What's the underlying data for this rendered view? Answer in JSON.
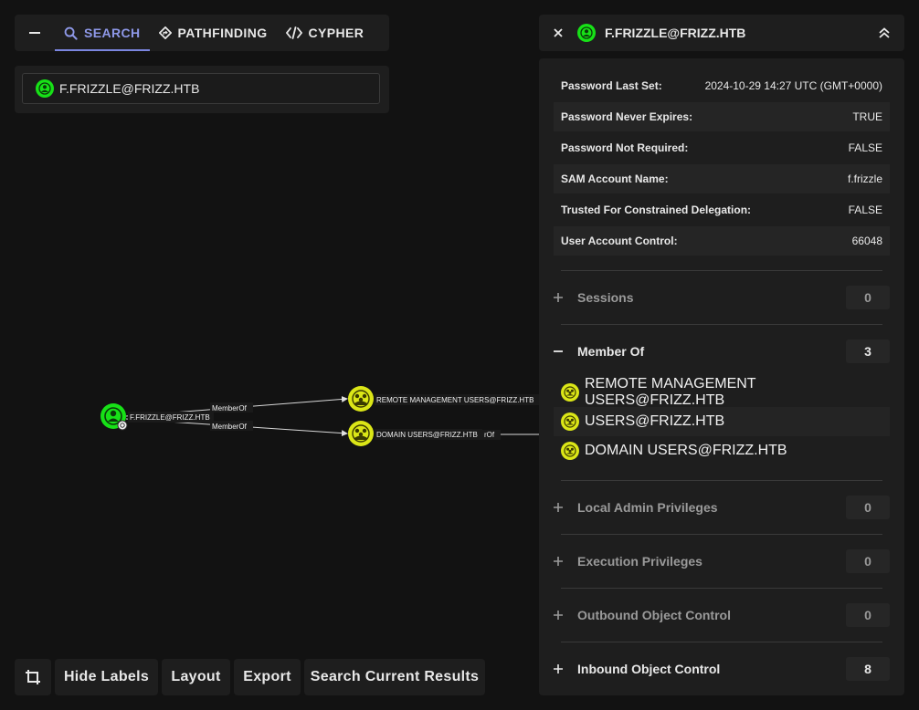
{
  "tabs": {
    "items": [
      {
        "label": "SEARCH",
        "icon": "search-icon",
        "active": true
      },
      {
        "label": "PATHFINDING",
        "icon": "pathfinding-icon",
        "active": false
      },
      {
        "label": "CYPHER",
        "icon": "code-icon",
        "active": false
      }
    ]
  },
  "search": {
    "value": "F.FRIZZLE@FRIZZ.HTB"
  },
  "graph": {
    "nodes": {
      "user": "F.FRIZZLE@FRIZZ.HTB",
      "group1": "REMOTE MANAGEMENT USERS@FRIZZ.HTB",
      "group2": "DOMAIN USERS@FRIZZ.HTB"
    },
    "edges": {
      "e1": "MemberOf",
      "e2": "MemberOf",
      "e3_partial": "rOf"
    }
  },
  "toolbar": {
    "hide_labels": "Hide Labels",
    "layout": "Layout",
    "export": "Export",
    "search_current": "Search Current Results"
  },
  "entity_panel": {
    "title": "F.FRIZZLE@FRIZZ.HTB",
    "properties": [
      {
        "key": "Password Last Set:",
        "value": "2024-10-29 14:27 UTC (GMT+0000)"
      },
      {
        "key": "Password Never Expires:",
        "value": "TRUE"
      },
      {
        "key": "Password Not Required:",
        "value": "FALSE"
      },
      {
        "key": "SAM Account Name:",
        "value": "f.frizzle"
      },
      {
        "key": "Trusted For Constrained Delegation:",
        "value": "FALSE"
      },
      {
        "key": "User Account Control:",
        "value": "66048"
      }
    ],
    "sections": {
      "sessions": {
        "title": "Sessions",
        "count": "0"
      },
      "member_of": {
        "title": "Member Of",
        "count": "3"
      },
      "local_admin": {
        "title": "Local Admin Privileges",
        "count": "0"
      },
      "execution": {
        "title": "Execution Privileges",
        "count": "0"
      },
      "outbound": {
        "title": "Outbound Object Control",
        "count": "0"
      },
      "inbound": {
        "title": "Inbound Object Control",
        "count": "8"
      }
    },
    "member_of_items": [
      "REMOTE MANAGEMENT USERS@FRIZZ.HTB",
      "USERS@FRIZZ.HTB",
      "DOMAIN USERS@FRIZZ.HTB"
    ]
  },
  "colors": {
    "user_node": "#17e117",
    "group_node": "#dbe617",
    "accent": "#8e98e8",
    "background": "#121212",
    "panel": "#1e1e1e"
  }
}
